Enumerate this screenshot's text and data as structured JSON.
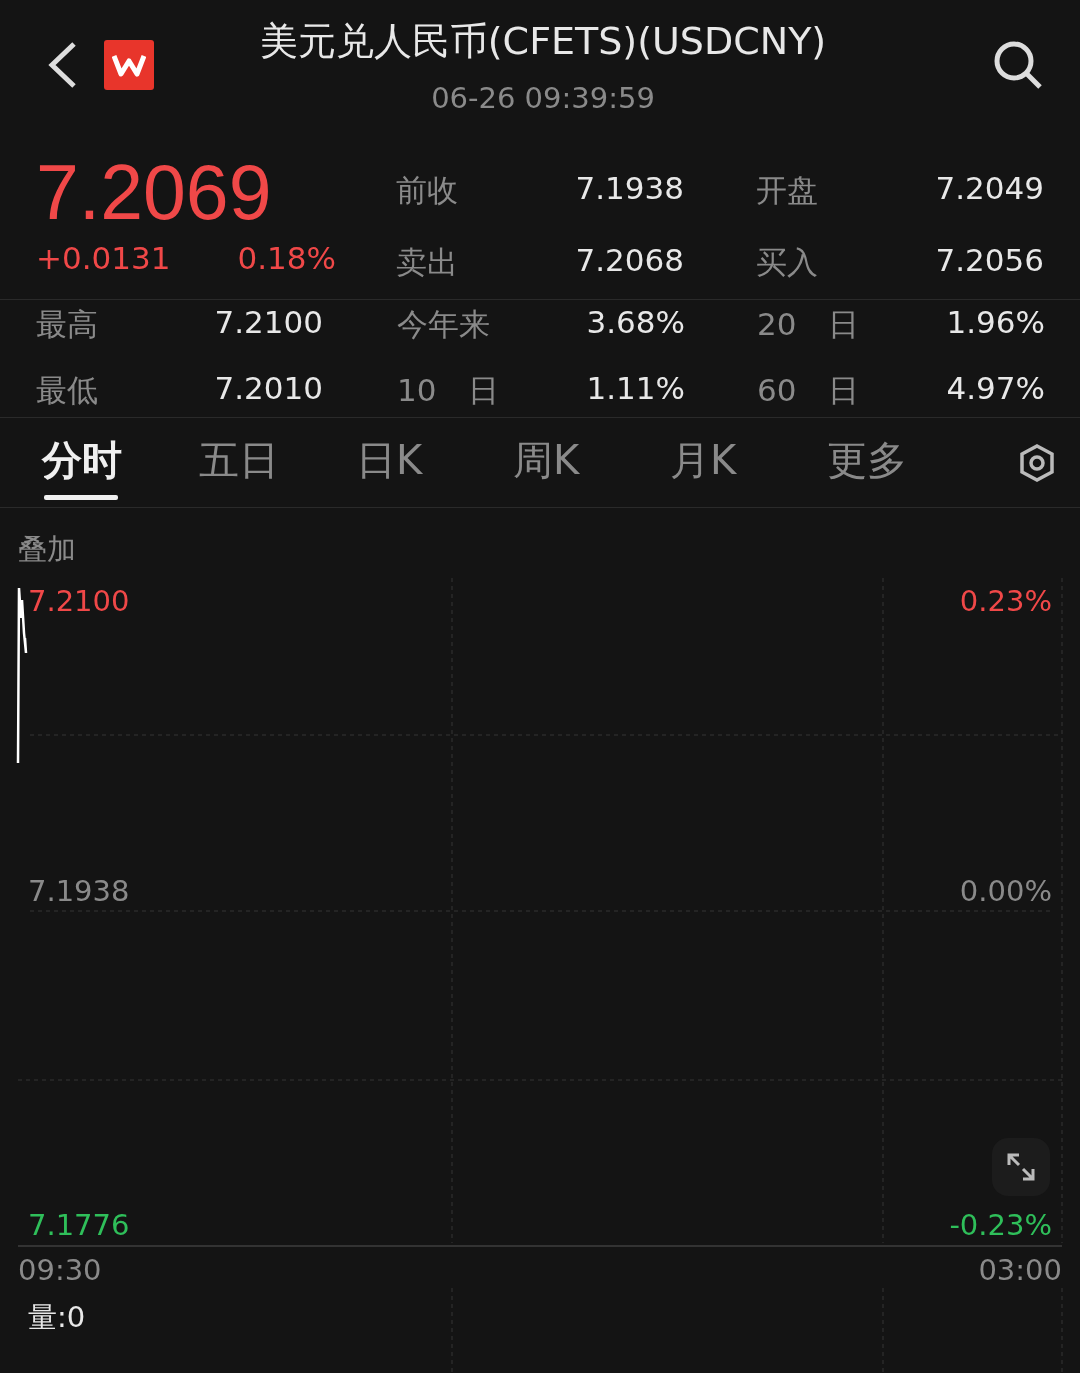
{
  "header": {
    "title": "美元兑人民币(CFETS)(USDCNY)",
    "time": "06-26 09:39:59"
  },
  "quote": {
    "price": "7.2069",
    "change": "+0.0131",
    "change_pct": "0.18%",
    "fields": [
      {
        "label": "前收",
        "value": "7.1938"
      },
      {
        "label": "开盘",
        "value": "7.2049"
      },
      {
        "label": "卖出",
        "value": "7.2068"
      },
      {
        "label": "买入",
        "value": "7.2056"
      }
    ]
  },
  "stats": [
    {
      "label": "最高",
      "value": "7.2100"
    },
    {
      "label": "今年来",
      "value": "3.68%"
    },
    {
      "label": "20 日",
      "value": "1.96%"
    },
    {
      "label": "最低",
      "value": "7.2010"
    },
    {
      "label": "10 日",
      "value": "1.11%"
    },
    {
      "label": "60 日",
      "value": "4.97%"
    }
  ],
  "tabs": [
    {
      "label": "分时",
      "selected": true
    },
    {
      "label": "五日",
      "selected": false
    },
    {
      "label": "日K",
      "selected": false
    },
    {
      "label": "周K",
      "selected": false
    },
    {
      "label": "月K",
      "selected": false
    },
    {
      "label": "更多",
      "selected": false
    }
  ],
  "chart": {
    "overlay": "叠加",
    "high": "7.2100",
    "high_pct": "0.23%",
    "mid": "7.1938",
    "mid_pct": "0.00%",
    "low": "7.1776",
    "low_pct": "-0.23%",
    "start_time": "09:30",
    "end_time": "03:00",
    "volume": "量:0"
  }
}
